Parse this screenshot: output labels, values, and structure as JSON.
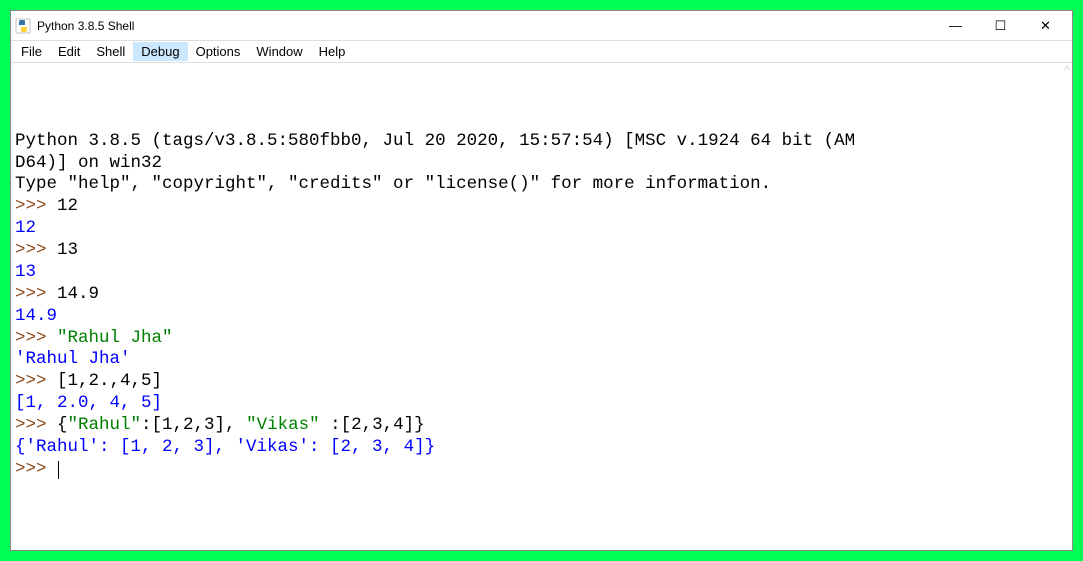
{
  "window": {
    "title": "Python 3.8.5 Shell"
  },
  "menu": {
    "file": "File",
    "edit": "Edit",
    "shell": "Shell",
    "debug": "Debug",
    "options": "Options",
    "window": "Window",
    "help": "Help"
  },
  "shell": {
    "banner_line1": "Python 3.8.5 (tags/v3.8.5:580fbb0, Jul 20 2020, 15:57:54) [MSC v.1924 64 bit (AM",
    "banner_line2": "D64)] on win32",
    "banner_line3": "Type \"help\", \"copyright\", \"credits\" or \"license()\" for more information.",
    "prompt": ">>> ",
    "entries": [
      {
        "input": "12",
        "output": "12",
        "input_is_string": false
      },
      {
        "input": "13",
        "output": "13",
        "input_is_string": false
      },
      {
        "input": "14.9",
        "output": "14.9",
        "input_is_string": false
      },
      {
        "input": "\"Rahul Jha\"",
        "output": "'Rahul Jha'",
        "input_is_string": true
      },
      {
        "input": "[1,2.,4,5]",
        "output": "[1, 2.0, 4, 5]",
        "input_is_string": false
      },
      {
        "input_parts": [
          {
            "t": "{",
            "cls": "plain"
          },
          {
            "t": "\"Rahul\"",
            "cls": "str-green"
          },
          {
            "t": ":[1,2,3], ",
            "cls": "plain"
          },
          {
            "t": "\"Vikas\"",
            "cls": "str-green"
          },
          {
            "t": " :[2,3,4]}",
            "cls": "plain"
          }
        ],
        "output": "{'Rahul': [1, 2, 3], 'Vikas': [2, 3, 4]}"
      }
    ]
  },
  "controls": {
    "minimize": "—",
    "maximize": "☐",
    "close": "✕"
  }
}
